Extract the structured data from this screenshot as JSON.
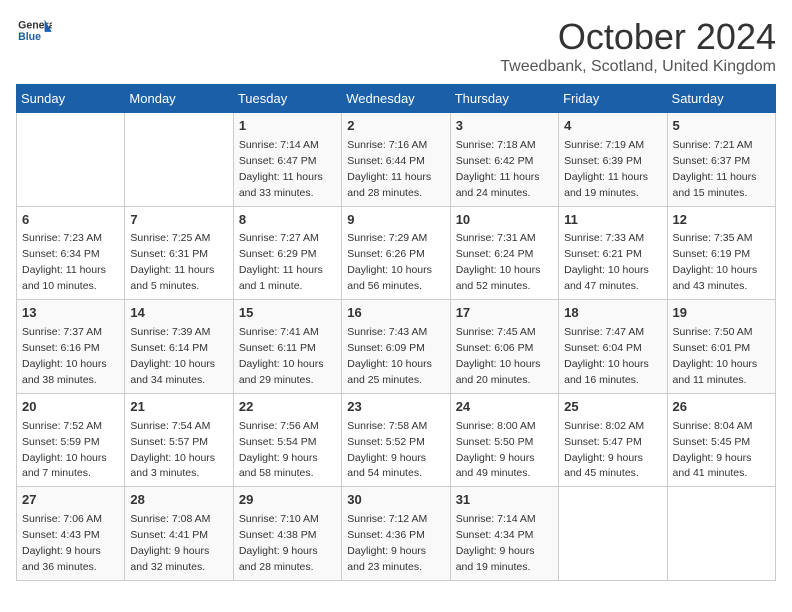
{
  "header": {
    "logo_line1": "General",
    "logo_line2": "Blue",
    "month": "October 2024",
    "location": "Tweedbank, Scotland, United Kingdom"
  },
  "days_of_week": [
    "Sunday",
    "Monday",
    "Tuesday",
    "Wednesday",
    "Thursday",
    "Friday",
    "Saturday"
  ],
  "weeks": [
    [
      {
        "day": "",
        "info": ""
      },
      {
        "day": "",
        "info": ""
      },
      {
        "day": "1",
        "info": "Sunrise: 7:14 AM\nSunset: 6:47 PM\nDaylight: 11 hours\nand 33 minutes."
      },
      {
        "day": "2",
        "info": "Sunrise: 7:16 AM\nSunset: 6:44 PM\nDaylight: 11 hours\nand 28 minutes."
      },
      {
        "day": "3",
        "info": "Sunrise: 7:18 AM\nSunset: 6:42 PM\nDaylight: 11 hours\nand 24 minutes."
      },
      {
        "day": "4",
        "info": "Sunrise: 7:19 AM\nSunset: 6:39 PM\nDaylight: 11 hours\nand 19 minutes."
      },
      {
        "day": "5",
        "info": "Sunrise: 7:21 AM\nSunset: 6:37 PM\nDaylight: 11 hours\nand 15 minutes."
      }
    ],
    [
      {
        "day": "6",
        "info": "Sunrise: 7:23 AM\nSunset: 6:34 PM\nDaylight: 11 hours\nand 10 minutes."
      },
      {
        "day": "7",
        "info": "Sunrise: 7:25 AM\nSunset: 6:31 PM\nDaylight: 11 hours\nand 5 minutes."
      },
      {
        "day": "8",
        "info": "Sunrise: 7:27 AM\nSunset: 6:29 PM\nDaylight: 11 hours\nand 1 minute."
      },
      {
        "day": "9",
        "info": "Sunrise: 7:29 AM\nSunset: 6:26 PM\nDaylight: 10 hours\nand 56 minutes."
      },
      {
        "day": "10",
        "info": "Sunrise: 7:31 AM\nSunset: 6:24 PM\nDaylight: 10 hours\nand 52 minutes."
      },
      {
        "day": "11",
        "info": "Sunrise: 7:33 AM\nSunset: 6:21 PM\nDaylight: 10 hours\nand 47 minutes."
      },
      {
        "day": "12",
        "info": "Sunrise: 7:35 AM\nSunset: 6:19 PM\nDaylight: 10 hours\nand 43 minutes."
      }
    ],
    [
      {
        "day": "13",
        "info": "Sunrise: 7:37 AM\nSunset: 6:16 PM\nDaylight: 10 hours\nand 38 minutes."
      },
      {
        "day": "14",
        "info": "Sunrise: 7:39 AM\nSunset: 6:14 PM\nDaylight: 10 hours\nand 34 minutes."
      },
      {
        "day": "15",
        "info": "Sunrise: 7:41 AM\nSunset: 6:11 PM\nDaylight: 10 hours\nand 29 minutes."
      },
      {
        "day": "16",
        "info": "Sunrise: 7:43 AM\nSunset: 6:09 PM\nDaylight: 10 hours\nand 25 minutes."
      },
      {
        "day": "17",
        "info": "Sunrise: 7:45 AM\nSunset: 6:06 PM\nDaylight: 10 hours\nand 20 minutes."
      },
      {
        "day": "18",
        "info": "Sunrise: 7:47 AM\nSunset: 6:04 PM\nDaylight: 10 hours\nand 16 minutes."
      },
      {
        "day": "19",
        "info": "Sunrise: 7:50 AM\nSunset: 6:01 PM\nDaylight: 10 hours\nand 11 minutes."
      }
    ],
    [
      {
        "day": "20",
        "info": "Sunrise: 7:52 AM\nSunset: 5:59 PM\nDaylight: 10 hours\nand 7 minutes."
      },
      {
        "day": "21",
        "info": "Sunrise: 7:54 AM\nSunset: 5:57 PM\nDaylight: 10 hours\nand 3 minutes."
      },
      {
        "day": "22",
        "info": "Sunrise: 7:56 AM\nSunset: 5:54 PM\nDaylight: 9 hours\nand 58 minutes."
      },
      {
        "day": "23",
        "info": "Sunrise: 7:58 AM\nSunset: 5:52 PM\nDaylight: 9 hours\nand 54 minutes."
      },
      {
        "day": "24",
        "info": "Sunrise: 8:00 AM\nSunset: 5:50 PM\nDaylight: 9 hours\nand 49 minutes."
      },
      {
        "day": "25",
        "info": "Sunrise: 8:02 AM\nSunset: 5:47 PM\nDaylight: 9 hours\nand 45 minutes."
      },
      {
        "day": "26",
        "info": "Sunrise: 8:04 AM\nSunset: 5:45 PM\nDaylight: 9 hours\nand 41 minutes."
      }
    ],
    [
      {
        "day": "27",
        "info": "Sunrise: 7:06 AM\nSunset: 4:43 PM\nDaylight: 9 hours\nand 36 minutes."
      },
      {
        "day": "28",
        "info": "Sunrise: 7:08 AM\nSunset: 4:41 PM\nDaylight: 9 hours\nand 32 minutes."
      },
      {
        "day": "29",
        "info": "Sunrise: 7:10 AM\nSunset: 4:38 PM\nDaylight: 9 hours\nand 28 minutes."
      },
      {
        "day": "30",
        "info": "Sunrise: 7:12 AM\nSunset: 4:36 PM\nDaylight: 9 hours\nand 23 minutes."
      },
      {
        "day": "31",
        "info": "Sunrise: 7:14 AM\nSunset: 4:34 PM\nDaylight: 9 hours\nand 19 minutes."
      },
      {
        "day": "",
        "info": ""
      },
      {
        "day": "",
        "info": ""
      }
    ]
  ]
}
